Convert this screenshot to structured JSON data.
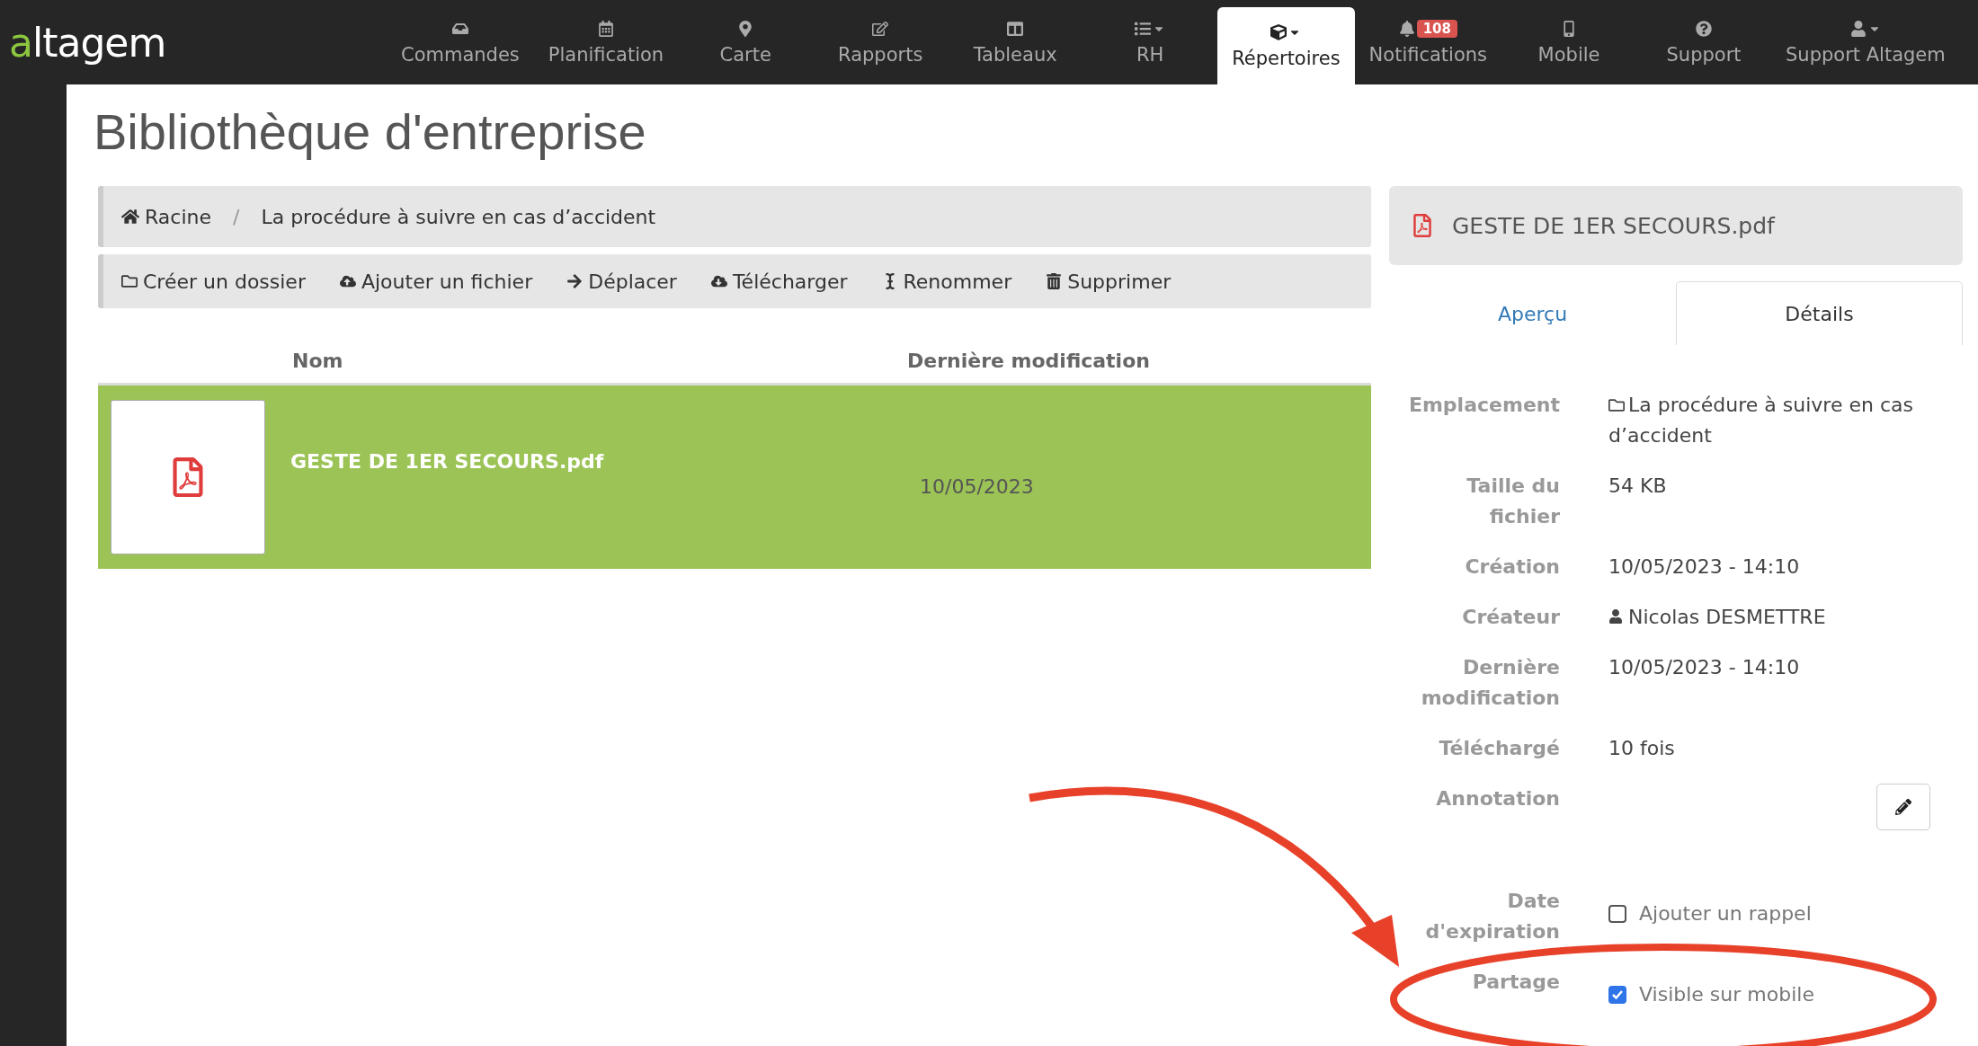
{
  "logo": {
    "lead": "a",
    "tail": "ltagem"
  },
  "nav": [
    {
      "label": "Commandes",
      "selected": false,
      "caret": false
    },
    {
      "label": "Planification",
      "selected": false,
      "caret": false
    },
    {
      "label": "Carte",
      "selected": false,
      "caret": false
    },
    {
      "label": "Rapports",
      "selected": false,
      "caret": false
    },
    {
      "label": "Tableaux",
      "selected": false,
      "caret": false
    },
    {
      "label": "RH",
      "selected": false,
      "caret": true
    },
    {
      "label": "Répertoires",
      "selected": true,
      "caret": true
    },
    {
      "label": "Notifications",
      "selected": false,
      "caret": false,
      "badge": "108"
    },
    {
      "label": "Mobile",
      "selected": false,
      "caret": false
    },
    {
      "label": "Support",
      "selected": false,
      "caret": false
    },
    {
      "label": "Support Altagem",
      "selected": false,
      "caret": true
    }
  ],
  "page_title": "Bibliothèque d'entreprise",
  "breadcrumb": [
    "Racine",
    "La procédure à suivre en cas d’accident"
  ],
  "breadcrumb_separator": "/",
  "toolbar": [
    "Créer un dossier",
    "Ajouter un fichier",
    "Déplacer",
    "Télécharger",
    "Renommer",
    "Supprimer"
  ],
  "table": {
    "columns": [
      "Nom",
      "Dernière modification"
    ],
    "rows": [
      {
        "name": "GESTE DE 1ER SECOURS.pdf",
        "modified": "10/05/2023",
        "selected": true
      }
    ]
  },
  "detail_panel": {
    "file_name": "GESTE DE 1ER SECOURS.pdf",
    "tabs": [
      {
        "label": "Aperçu",
        "selected": false
      },
      {
        "label": "Détails",
        "selected": true
      }
    ],
    "fields": [
      {
        "kind": "folder",
        "label": "Emplacement",
        "value": "La procédure à suivre en cas d’accident"
      },
      {
        "kind": "text",
        "label": "Taille du fichier",
        "value": "54 KB"
      },
      {
        "kind": "text",
        "label": "Création",
        "value": "10/05/2023 - 14:10"
      },
      {
        "kind": "user",
        "label": "Créateur",
        "value": "Nicolas DESMETTRE"
      },
      {
        "kind": "text",
        "label": "Dernière modification",
        "value": "10/05/2023 - 14:10"
      },
      {
        "kind": "text",
        "label": "Téléchargé",
        "value": "10 fois"
      },
      {
        "kind": "edit",
        "label": "Annotation"
      },
      {
        "kind": "checkbox",
        "label": "Date d'expiration",
        "value": "Ajouter un rappel",
        "checked": false
      },
      {
        "kind": "checkbox",
        "label": "Partage",
        "value": "Visible sur mobile",
        "checked": true
      }
    ]
  }
}
